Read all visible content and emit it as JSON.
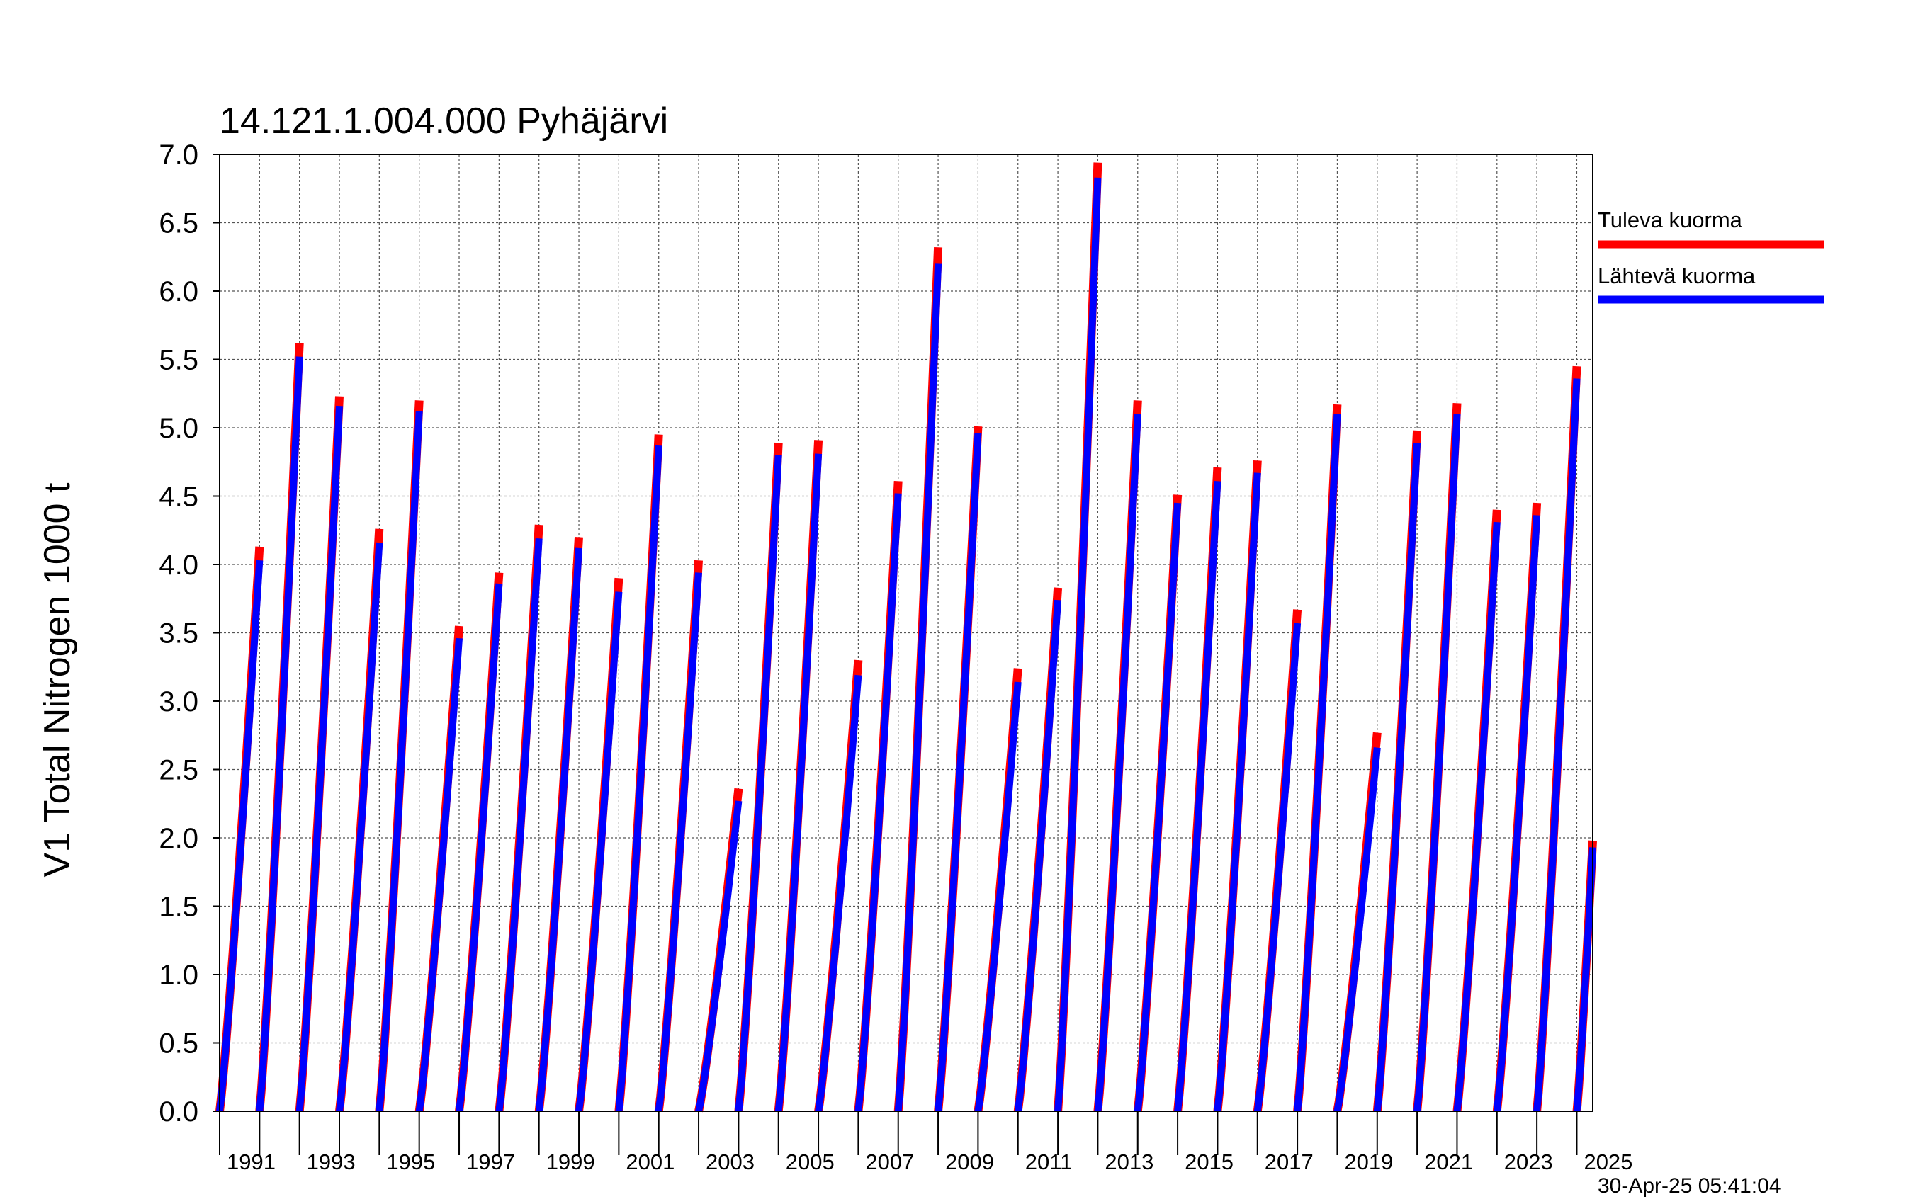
{
  "title": "14.121.1.004.000 Pyhäjärvi",
  "timestamp": "30-Apr-25 05:41:04",
  "chart_data": {
    "type": "line",
    "title": "14.121.1.004.000 Pyhäjärvi",
    "ylabel": "V1 Total Nitrogen 1000 t",
    "xlabel": "",
    "ylim": [
      0.0,
      7.0
    ],
    "yticks": [
      "0.0",
      "0.5",
      "1.0",
      "1.5",
      "2.0",
      "2.5",
      "3.0",
      "3.5",
      "4.0",
      "4.5",
      "5.0",
      "5.5",
      "6.0",
      "6.5",
      "7.0"
    ],
    "xlim": [
      1990,
      2024.4
    ],
    "xtick_labels": [
      "1991",
      "1993",
      "1995",
      "1997",
      "1999",
      "2001",
      "2003",
      "2005",
      "2007",
      "2009",
      "2011",
      "2013",
      "2015",
      "2017",
      "2019",
      "2021",
      "2023",
      "2025"
    ],
    "grid": true,
    "legend_position": "right",
    "colors": {
      "Tuleva kuorma": "#ff0000",
      "Lähtevä kuorma": "#0000ff"
    },
    "series": [
      {
        "name": "Tuleva kuorma",
        "annual_max": [
          4.13,
          5.62,
          5.23,
          4.26,
          5.2,
          3.55,
          3.94,
          4.29,
          4.2,
          3.9,
          4.95,
          4.03,
          2.36,
          4.89,
          4.91,
          3.3,
          4.61,
          6.32,
          5.01,
          3.24,
          3.83,
          6.94,
          5.2,
          4.51,
          4.71,
          4.76,
          3.67,
          5.17,
          2.77,
          4.98,
          5.18,
          4.4,
          4.45,
          5.45,
          1.98
        ]
      },
      {
        "name": "Lähtevä kuorma",
        "annual_max": [
          4.03,
          5.52,
          5.16,
          4.16,
          5.12,
          3.46,
          3.86,
          4.19,
          4.12,
          3.8,
          4.87,
          3.94,
          2.27,
          4.8,
          4.81,
          3.19,
          4.52,
          6.2,
          4.96,
          3.14,
          3.74,
          6.83,
          5.1,
          4.45,
          4.61,
          4.67,
          3.57,
          5.1,
          2.66,
          4.89,
          5.1,
          4.31,
          4.36,
          5.36,
          1.93
        ]
      }
    ],
    "years": [
      1990,
      1991,
      1992,
      1993,
      1994,
      1995,
      1996,
      1997,
      1998,
      1999,
      2000,
      2001,
      2002,
      2003,
      2004,
      2005,
      2006,
      2007,
      2008,
      2009,
      2010,
      2011,
      2012,
      2013,
      2014,
      2015,
      2016,
      2017,
      2018,
      2019,
      2020,
      2021,
      2022,
      2023,
      2024
    ]
  }
}
